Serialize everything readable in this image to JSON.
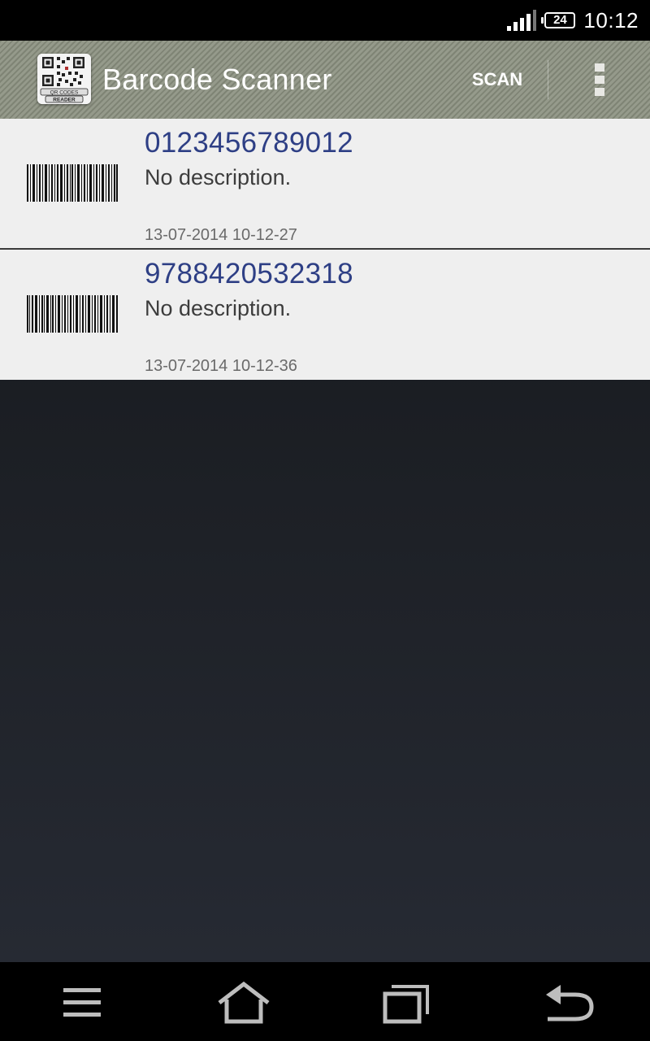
{
  "status_bar": {
    "battery_level": "24",
    "time": "10:12",
    "icons": [
      "signal-icon",
      "battery-icon"
    ]
  },
  "action_bar": {
    "app_icon": "qr-code-reader-logo",
    "app_icon_text": [
      "QR CODES",
      "READER"
    ],
    "title": "Barcode Scanner",
    "scan_label": "SCAN",
    "overflow_icon": "overflow-menu-icon"
  },
  "items": [
    {
      "code": "0123456789012",
      "description": "No description.",
      "date": "13-07-2014 10-12-27",
      "thumb_icon": "barcode-icon"
    },
    {
      "code": "9788420532318",
      "description": "No description.",
      "date": "13-07-2014 10-12-36",
      "thumb_icon": "barcode-icon"
    }
  ],
  "nav_bar": {
    "icons": [
      "menu-icon",
      "home-icon",
      "recent-apps-icon",
      "back-icon"
    ]
  },
  "colors": {
    "action_bar": "#8a8f80",
    "code_text": "#2e3f85",
    "list_bg": "#efefef",
    "content_bg": "#1e2127"
  }
}
